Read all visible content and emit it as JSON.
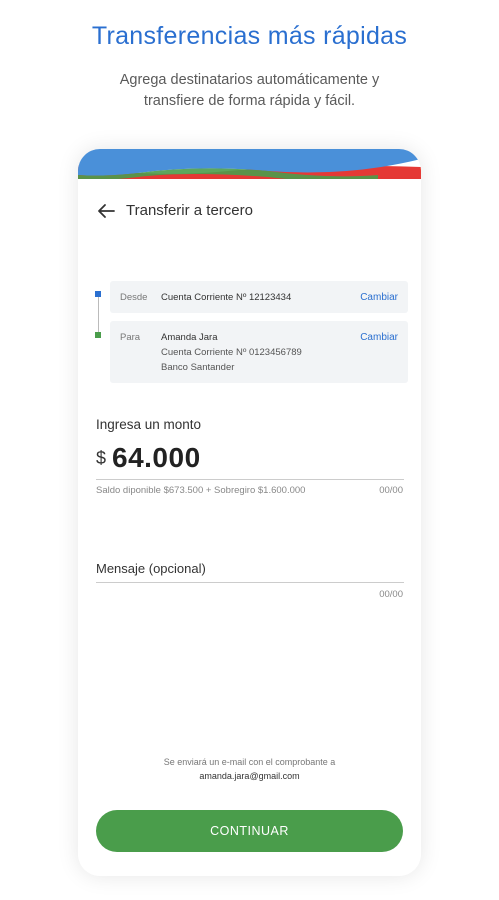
{
  "promo": {
    "title": "Transferencias más rápidas",
    "subtitle_line1": "Agrega destinatarios automáticamente y",
    "subtitle_line2": "transfiere de forma rápida y fácil."
  },
  "header": {
    "title": "Transferir a tercero",
    "back_icon": "arrow-left-icon"
  },
  "from": {
    "label": "Desde",
    "account": "Cuenta Corriente Nº 12123434",
    "change": "Cambiar"
  },
  "to": {
    "label": "Para",
    "name": "Amanda Jara",
    "account": "Cuenta Corriente Nº 0123456789",
    "bank": "Banco Santander",
    "change": "Cambiar"
  },
  "amount": {
    "label": "Ingresa un monto",
    "currency": "$",
    "value": "64.000",
    "balance_note": "Saldo diponible $673.500 + Sobregiro $1.600.000",
    "counter": "00/00"
  },
  "message": {
    "label": "Mensaje (opcional)",
    "counter": "00/00"
  },
  "email_note": {
    "text": "Se enviará un e-mail con el comprobante a",
    "address": "amanda.jara@gmail.com"
  },
  "cta": {
    "label": "CONTINUAR"
  },
  "colors": {
    "accent_blue": "#2a6fd0",
    "accent_green": "#4a9d4b",
    "wave_red": "#e53935",
    "wave_yellow": "#f7d81c"
  }
}
